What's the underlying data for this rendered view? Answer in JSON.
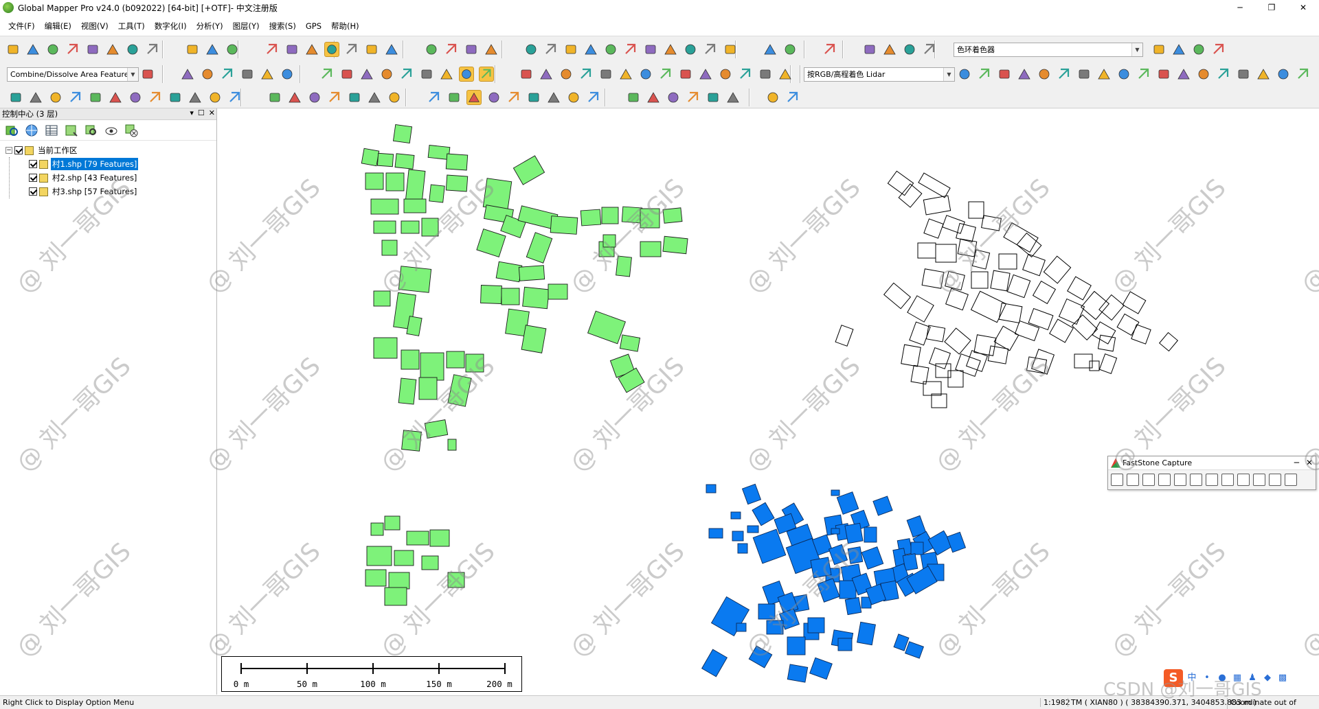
{
  "window": {
    "title": "Global Mapper Pro v24.0 (b092022) [64-bit] [+OTF]- 中文注册版",
    "minimize": "─",
    "restore": "❐",
    "close": "✕"
  },
  "menu": [
    {
      "label": "文件(F)"
    },
    {
      "label": "编辑(E)"
    },
    {
      "label": "视图(V)"
    },
    {
      "label": "工具(T)"
    },
    {
      "label": "数字化(I)"
    },
    {
      "label": "分析(Y)"
    },
    {
      "label": "图层(Y)"
    },
    {
      "label": "搜索(S)"
    },
    {
      "label": "GPS"
    },
    {
      "label": "帮助(H)"
    }
  ],
  "toolbar": {
    "shader_combo": "色环着色器",
    "area_combo": "Combine/Dissolve Area Features",
    "lidar_combo": "按RGB/高程着色 Lidar",
    "combo_arrow": "▼"
  },
  "control_center": {
    "title": "控制中心 (3 层)",
    "pin": "▾",
    "float": "☐",
    "close": "✕",
    "root": "当前工作区",
    "root_expander": "−",
    "layers": [
      {
        "label": "村1.shp [79 Features]",
        "selected": true
      },
      {
        "label": "村2.shp [43 Features]",
        "selected": false
      },
      {
        "label": "村3.shp [57 Features]",
        "selected": false
      }
    ]
  },
  "scale_bar": {
    "labels": [
      "0 m",
      "50 m",
      "100 m",
      "150 m",
      "200 m"
    ]
  },
  "faststone": {
    "title": "FastStone Capture",
    "minimize": "─",
    "close": "✕"
  },
  "statusbar": {
    "hint": "Right Click to Display Option Menu",
    "scale": "1:1982",
    "coords": "TM ( XIAN80 ) ( 38384390.371, 3404853.883 m )",
    "range": "Coordinate out of range"
  },
  "tray": {
    "ime": "S",
    "lang": "中"
  },
  "watermark": {
    "text": "@ 刘一哥GIS",
    "csdn": "CSDN @刘一哥GIS"
  },
  "colors": {
    "layer1_fill": "#7ef27a",
    "layer3_fill": "#0a7af0",
    "layer2_stroke": "#000000",
    "pressed_tool": "#f6c343"
  }
}
